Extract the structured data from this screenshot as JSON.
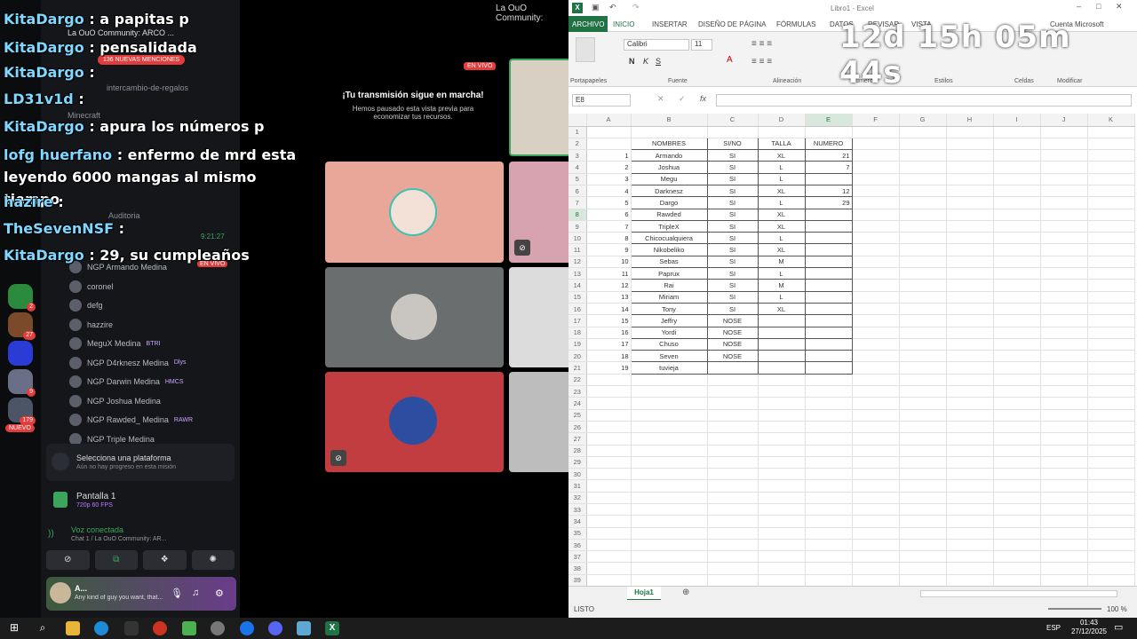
{
  "discord": {
    "top_server": "La OuO Community: ARCO ...",
    "mentions_badge": "136 NUEVAS MENCIONES",
    "channels": [
      "intercambio-de-regalos",
      "Minecraft",
      "Auditoria"
    ],
    "stream_time": "9:21:27",
    "live_badge": "EN VIVO",
    "voice_users": [
      "NGP Armando Medina",
      "coronel",
      "defg",
      "hazzire",
      "MeguX Medina",
      "NGP D4rknesz Medina",
      "NGP Darwin Medina",
      "NGP Joshua Medina",
      "NGP Rawded_ Medina",
      "NGP Triple Medina"
    ],
    "voice_tags": [
      "",
      "",
      "",
      "",
      "BTRI",
      "Dlys",
      "HMCS",
      "",
      "RAWR",
      ""
    ],
    "platform_title": "Selecciona una plataforma",
    "platform_sub": "Aún no hay progreso en esta misión",
    "screen_label": "Pantalla 1",
    "screen_sub": "720p 60 FPS",
    "voice_status": "Voz conectada",
    "voice_channel": "Chat 1 / La OuO Community: AR...",
    "user_name": "A...",
    "user_status": "Any kind of guy you want, that...",
    "new_badge": "NUEVO",
    "server_badges": [
      "2",
      "27",
      "9",
      "179"
    ]
  },
  "stream_notice": {
    "title": "¡Tu transmisión sigue en marcha!",
    "body": "Hemos pausado esta vista previa para economizar tus recursos.",
    "live": "EN VIVO",
    "header": "La OuO Community:"
  },
  "overlay_chat": [
    {
      "name": "KitaDargo",
      "msg": ": a papitas p"
    },
    {
      "name": "KitaDargo",
      "msg": ": pensalidada"
    },
    {
      "name": "KitaDargo",
      "msg": ":"
    },
    {
      "name": "LD31v1d",
      "msg": ":"
    },
    {
      "name": "KitaDargo",
      "msg": ": apura los números p"
    },
    {
      "name": "lofg huerfano",
      "msg": ": enfermo de mrd esta leyendo 6000 mangas al mismo tiempo"
    },
    {
      "name": "hazire",
      "msg": ":"
    },
    {
      "name": "TheSevenNSF",
      "msg": ":"
    },
    {
      "name": "KitaDargo",
      "msg": ": 29, su cumpleaños"
    }
  ],
  "timer": "12d 15h 05m 44s",
  "excel": {
    "title": "Libro1 - Excel",
    "account": "Cuenta Microsoft",
    "tabs": [
      "ARCHIVO",
      "INICIO",
      "INSERTAR",
      "DISEÑO DE PÁGINA",
      "FÓRMULAS",
      "DATOS",
      "REVISAR",
      "VISTA"
    ],
    "font_name": "Calibri",
    "font_size": "11",
    "groups": [
      "Portapapeles",
      "Fuente",
      "Alineación",
      "Número",
      "Estilos",
      "Celdas",
      "Modificar"
    ],
    "name_box": "E8",
    "columns": [
      "A",
      "B",
      "C",
      "D",
      "E",
      "F",
      "G",
      "H",
      "I",
      "J",
      "K"
    ],
    "headers": [
      "NOMBRES",
      "SI/NO",
      "TALLA",
      "NUMERO"
    ],
    "rows": [
      [
        "1",
        "Armando",
        "SI",
        "XL",
        "21"
      ],
      [
        "2",
        "Joshua",
        "SI",
        "L",
        "7"
      ],
      [
        "3",
        "Megu",
        "SI",
        "L",
        ""
      ],
      [
        "4",
        "Darknesz",
        "SI",
        "XL",
        "12"
      ],
      [
        "5",
        "Dargo",
        "SI",
        "L",
        "29"
      ],
      [
        "6",
        "Rawded",
        "SI",
        "XL",
        ""
      ],
      [
        "7",
        "TripleX",
        "SI",
        "XL",
        ""
      ],
      [
        "8",
        "Chicocualquiera",
        "SI",
        "L",
        ""
      ],
      [
        "9",
        "Nikobeliko",
        "SI",
        "XL",
        ""
      ],
      [
        "10",
        "Sebas",
        "SI",
        "M",
        ""
      ],
      [
        "11",
        "Paprux",
        "SI",
        "L",
        ""
      ],
      [
        "12",
        "Rai",
        "SI",
        "M",
        ""
      ],
      [
        "13",
        "Miriam",
        "SI",
        "L",
        ""
      ],
      [
        "14",
        "Tony",
        "SI",
        "XL",
        ""
      ],
      [
        "15",
        "Jeffry",
        "NOSE",
        "",
        ""
      ],
      [
        "16",
        "Yordi",
        "NOSE",
        "",
        ""
      ],
      [
        "17",
        "Chuso",
        "NOSE",
        "",
        ""
      ],
      [
        "18",
        "Seven",
        "NOSE",
        "",
        ""
      ],
      [
        "19",
        "tuvieja",
        "",
        "",
        ""
      ]
    ],
    "sheet_tab": "Hoja1",
    "status": "LISTO",
    "zoom": "100 %"
  },
  "taskbar": {
    "lang": "ESP",
    "time": "01:43",
    "date": "27/12/2025"
  },
  "colors": {
    "excel_green": "#217346",
    "discord_bg": "#111214",
    "accent_blue": "#5fd0ff"
  }
}
